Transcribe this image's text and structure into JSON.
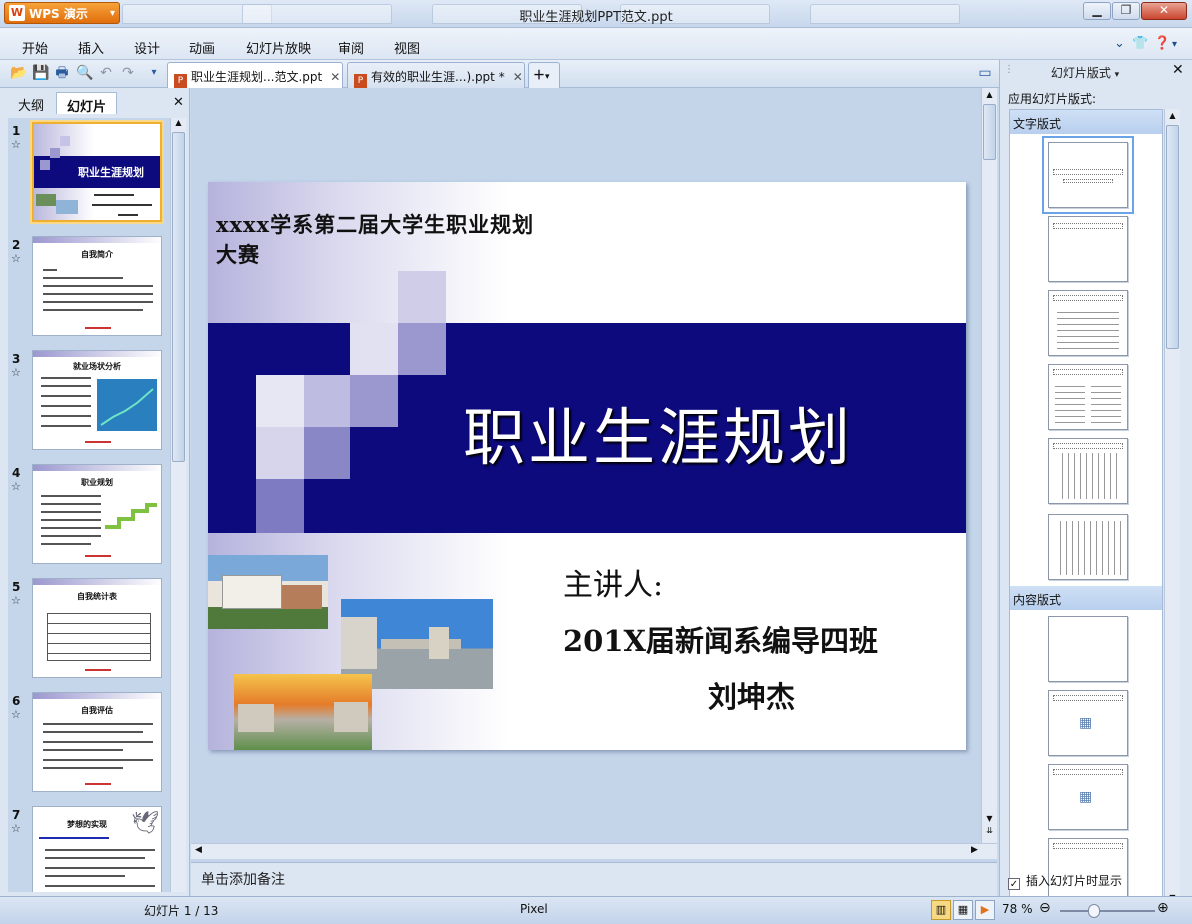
{
  "window": {
    "app_name": "WPS 演示",
    "title": "职业生涯规划PPT范文.ppt"
  },
  "menu": [
    "开始",
    "插入",
    "设计",
    "动画",
    "幻灯片放映",
    "审阅",
    "视图"
  ],
  "doc_tabs": [
    {
      "label": "职业生涯规划...范文.ppt",
      "active": true
    },
    {
      "label": "有效的职业生涯...).ppt *",
      "active": false
    }
  ],
  "left_panel": {
    "tabs": [
      "大纲",
      "幻灯片"
    ],
    "active_tab": "幻灯片",
    "thumbs": [
      {
        "num": "1",
        "title": "职业生涯规划"
      },
      {
        "num": "2",
        "title": "自我简介"
      },
      {
        "num": "3",
        "title": "就业场状分析"
      },
      {
        "num": "4",
        "title": "职业规划"
      },
      {
        "num": "5",
        "title": "自我统计表"
      },
      {
        "num": "6",
        "title": "自我评估"
      },
      {
        "num": "7",
        "title": "梦想的实现"
      }
    ]
  },
  "slide": {
    "top_text": "xxxx学系第二届大学生职业规划大赛",
    "main_title": "职业生涯规划",
    "presenter": "主讲人:",
    "class_line": "201X届新闻系编导四班",
    "speaker_name": "刘坤杰",
    "colors": {
      "band": "#0d0a7e",
      "squares": "#9b98cf"
    }
  },
  "notes_placeholder": "单击添加备注",
  "right_panel": {
    "title": "幻灯片版式",
    "apply_label": "应用幻灯片版式:",
    "section_text": "文字版式",
    "section_content": "内容版式",
    "checkbox_label": "插入幻灯片时显示",
    "checkbox_checked": true
  },
  "status": {
    "slide_info": "幻灯片 1 / 13",
    "theme": "Pixel",
    "zoom": "78 %"
  }
}
